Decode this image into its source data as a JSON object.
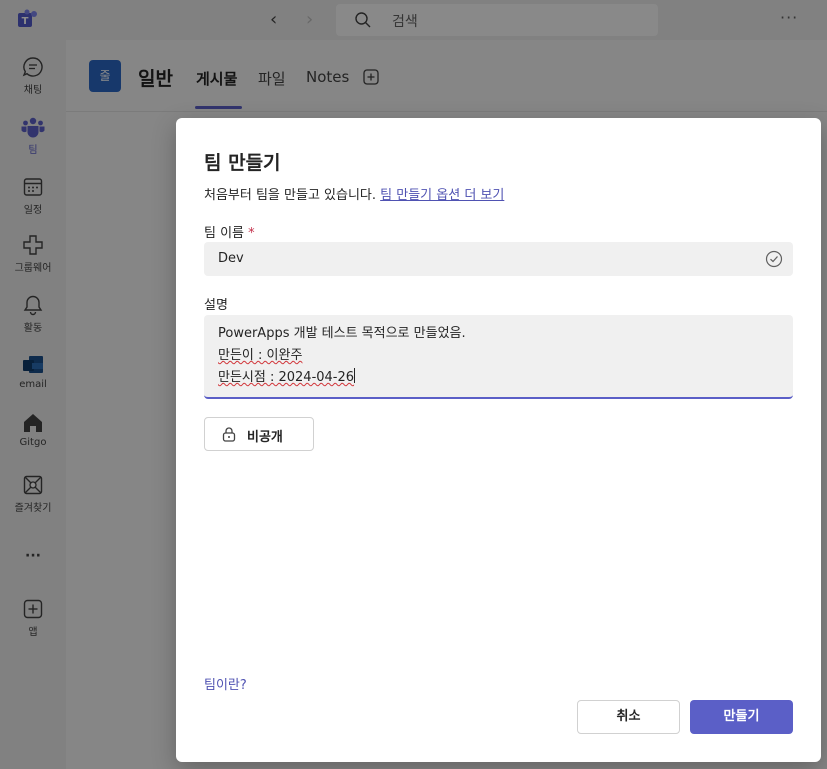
{
  "titlebar": {
    "back_glyph": "‹",
    "forward_glyph": "›",
    "search_placeholder": "검색",
    "more_glyph": "···"
  },
  "rail": {
    "items": [
      {
        "label": "채팅",
        "icon": "chat-icon"
      },
      {
        "label": "팀",
        "icon": "teams-icon"
      },
      {
        "label": "일정",
        "icon": "calendar-icon"
      },
      {
        "label": "그룹웨어",
        "icon": "groupware-icon"
      },
      {
        "label": "활동",
        "icon": "bell-icon"
      },
      {
        "label": "email",
        "icon": "email-icon"
      },
      {
        "label": "Gitgo",
        "icon": "home-icon"
      },
      {
        "label": "즐겨찾기",
        "icon": "favorites-icon"
      },
      {
        "label": "···",
        "icon": "more-apps-icon"
      },
      {
        "label": "앱",
        "icon": "apps-add-icon"
      }
    ],
    "active_index": 1
  },
  "channel": {
    "avatar_text": "줄",
    "name": "일반",
    "tabs": [
      "게시물",
      "파일",
      "Notes"
    ]
  },
  "dialog": {
    "title": "팀 만들기",
    "subtitle_prefix": "처음부터 팀을 만들고 있습니다.",
    "subtitle_link": "팀 만들기 옵션 더 보기",
    "name_label": "팀 이름",
    "required_mark": "*",
    "name_value": "Dev",
    "desc_label": "설명",
    "desc_lines": [
      "PowerApps 개발 테스트 목적으로 만들었음.",
      "만든이 : 이완주",
      "만든시점 : 2024-04-26"
    ],
    "privacy_label": "비공개",
    "about_link": "팀이란?",
    "cancel_label": "취소",
    "create_label": "만들기"
  },
  "colors": {
    "accent": "#5b5fc7",
    "link": "#4f52b2",
    "team_avatar": "#2b66c4"
  }
}
